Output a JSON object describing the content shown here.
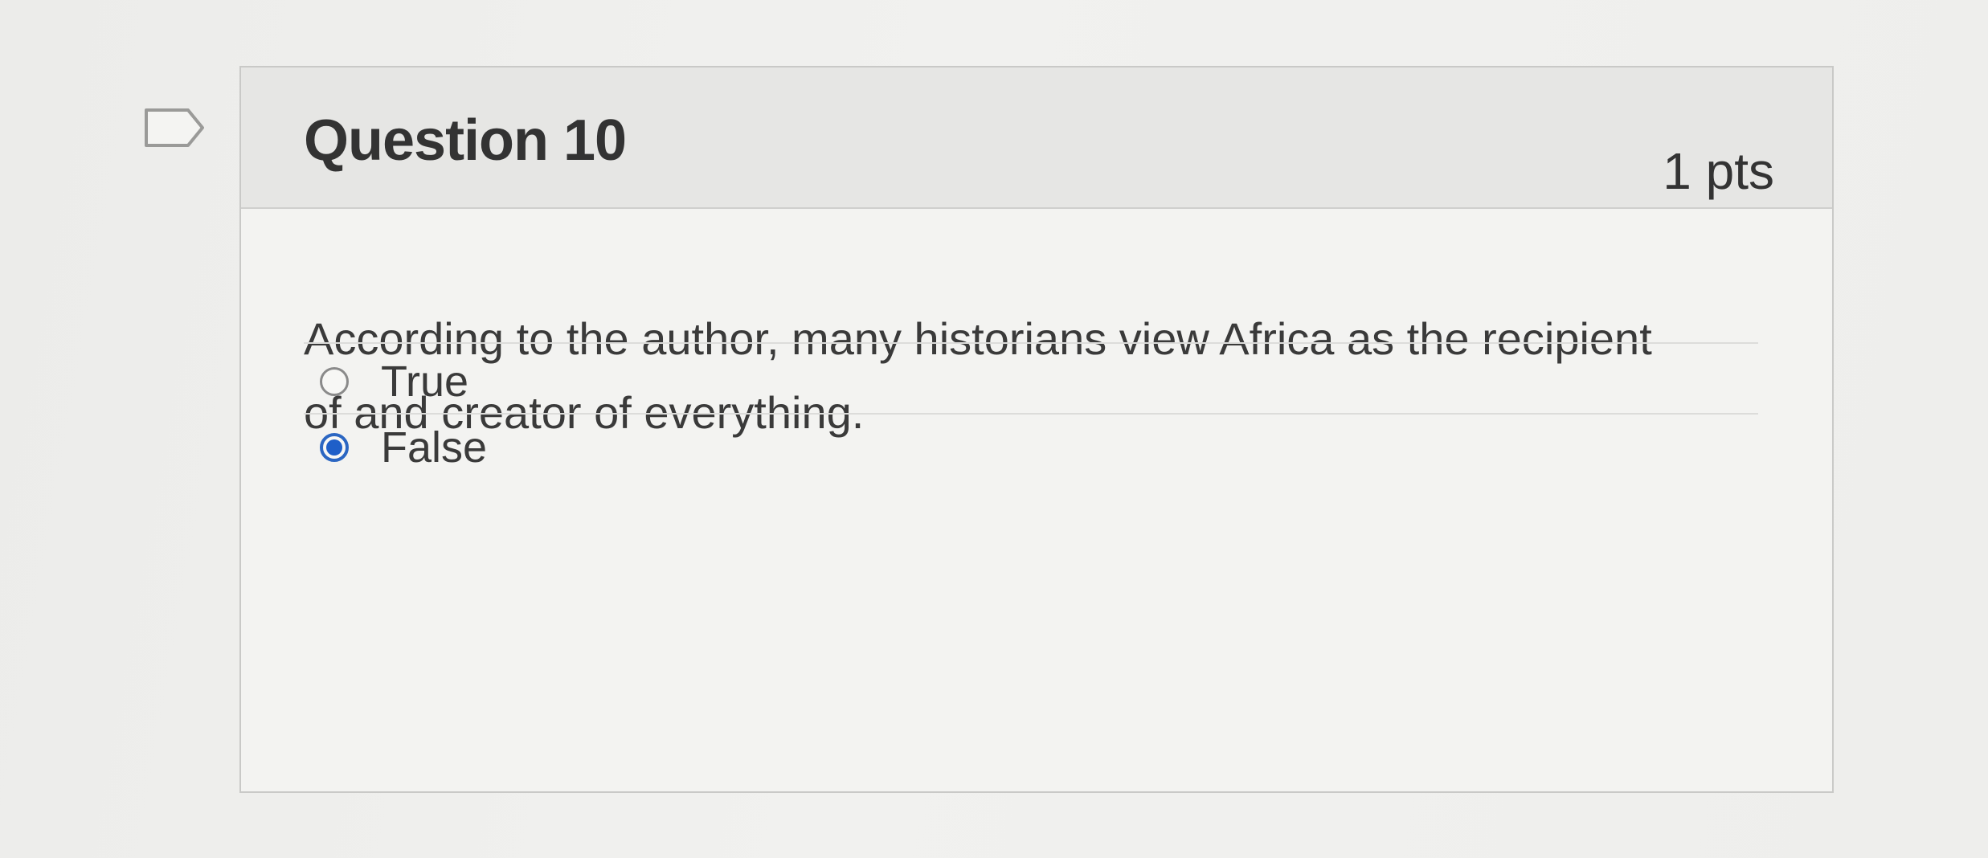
{
  "question": {
    "title": "Question 10",
    "points": "1 pts",
    "text": "According to the author, many historians view Africa as the recipient of and creator of everything.",
    "flag_icon": "flag-outline-icon",
    "answers": [
      {
        "label": "True",
        "selected": false
      },
      {
        "label": "False",
        "selected": true
      }
    ],
    "accent_color": "#2b66c2"
  }
}
